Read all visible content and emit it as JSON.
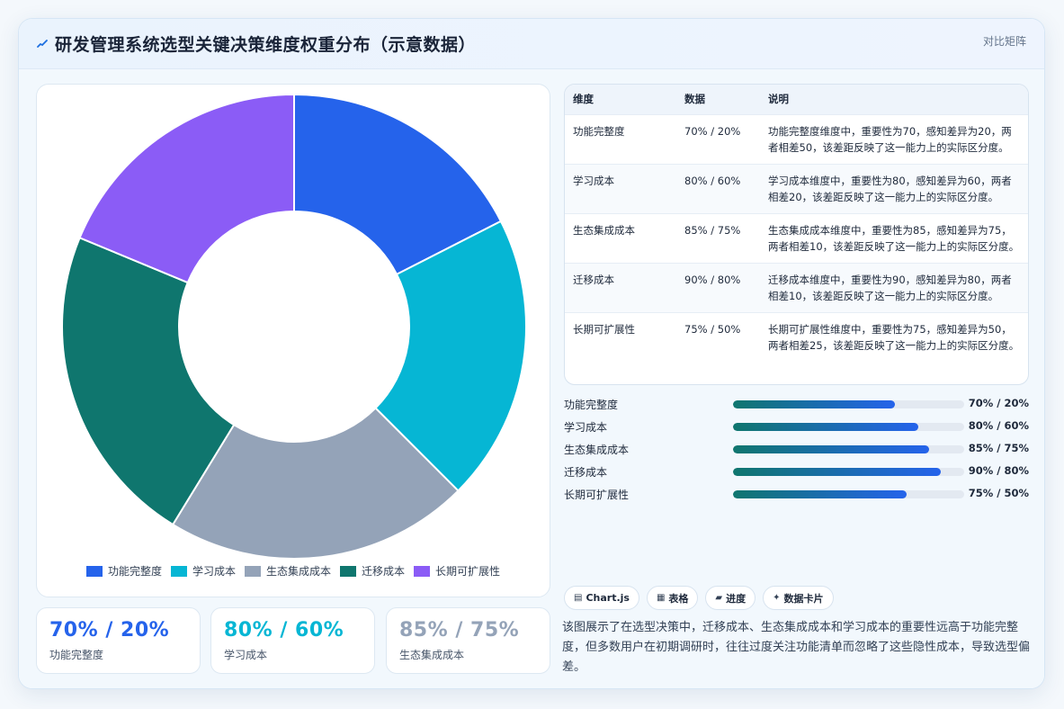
{
  "header": {
    "title": "研发管理系统选型关键决策维度权重分布（示意数据）",
    "tag": "对比矩阵",
    "icon": "chart-line-icon"
  },
  "colors": {
    "blue": "#2563eb",
    "cyan": "#06b6d4",
    "gray": "#94a3b8",
    "teal": "#0f766e",
    "purple": "#8b5cf6"
  },
  "chart_data": {
    "type": "pie",
    "variant": "doughnut",
    "labels": [
      "功能完整度",
      "学习成本",
      "生态集成成本",
      "迁移成本",
      "长期可扩展性"
    ],
    "values": [
      70,
      80,
      85,
      90,
      75
    ],
    "colors": [
      "#2563eb",
      "#06b6d4",
      "#94a3b8",
      "#0f766e",
      "#8b5cf6"
    ],
    "legend": "bottom"
  },
  "stats": [
    {
      "value": "70% / 20%",
      "label": "功能完整度",
      "color": "#2563eb"
    },
    {
      "value": "80% / 60%",
      "label": "学习成本",
      "color": "#06b6d4"
    },
    {
      "value": "85% / 75%",
      "label": "生态集成成本",
      "color": "#94a3b8"
    }
  ],
  "table": {
    "headers": [
      "维度",
      "数据",
      "说明"
    ],
    "rows": [
      {
        "dim": "功能完整度",
        "data": "70% / 20%",
        "desc": "功能完整度维度中，重要性为70，感知差异为20，两者相差50，该差距反映了这一能力上的实际区分度。"
      },
      {
        "dim": "学习成本",
        "data": "80% / 60%",
        "desc": "学习成本维度中，重要性为80，感知差异为60，两者相差20，该差距反映了这一能力上的实际区分度。"
      },
      {
        "dim": "生态集成成本",
        "data": "85% / 75%",
        "desc": "生态集成成本维度中，重要性为85，感知差异为75，两者相差10，该差距反映了这一能力上的实际区分度。"
      },
      {
        "dim": "迁移成本",
        "data": "90% / 80%",
        "desc": "迁移成本维度中，重要性为90，感知差异为80，两者相差10，该差距反映了这一能力上的实际区分度。"
      },
      {
        "dim": "长期可扩展性",
        "data": "75% / 50%",
        "desc": "长期可扩展性维度中，重要性为75，感知差异为50，两者相差25，该差距反映了这一能力上的实际区分度。"
      }
    ]
  },
  "progress": [
    {
      "label": "功能完整度",
      "value": "70% / 20%",
      "fill": 0.7
    },
    {
      "label": "学习成本",
      "value": "80% / 60%",
      "fill": 0.8
    },
    {
      "label": "生态集成成本",
      "value": "85% / 75%",
      "fill": 0.85
    },
    {
      "label": "迁移成本",
      "value": "90% / 80%",
      "fill": 0.9
    },
    {
      "label": "长期可扩展性",
      "value": "75% / 50%",
      "fill": 0.75
    }
  ],
  "chips": [
    {
      "icon": "chart-icon",
      "glyph": "▤",
      "label": "Chart.js"
    },
    {
      "icon": "table-icon",
      "glyph": "▦",
      "label": "表格"
    },
    {
      "icon": "folder-icon",
      "glyph": "▰",
      "label": "进度"
    },
    {
      "icon": "sparkle-icon",
      "glyph": "✦",
      "label": "数据卡片"
    }
  ],
  "description": "该图展示了在选型决策中，迁移成本、生态集成成本和学习成本的重要性远高于功能完整度，但多数用户在初期调研时，往往过度关注功能清单而忽略了这些隐性成本，导致选型偏差。"
}
